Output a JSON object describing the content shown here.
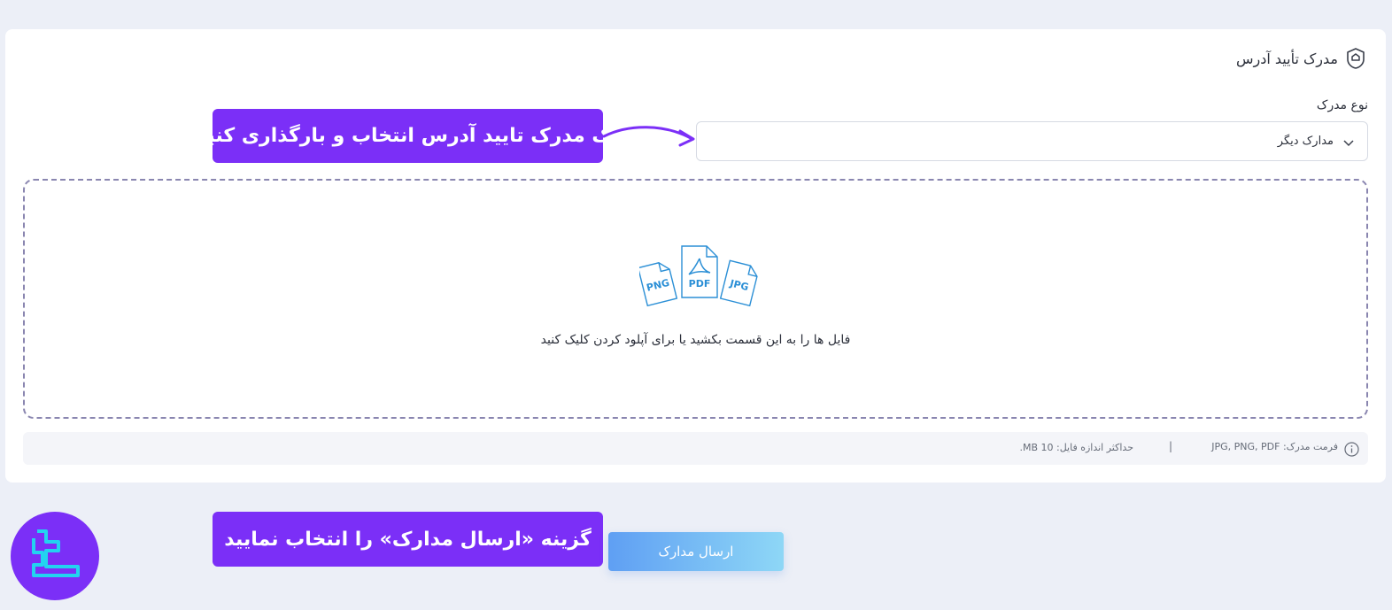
{
  "section": {
    "title": "مدرک تأیید آدرس",
    "title_icon": "home-shield-icon"
  },
  "document_type": {
    "label": "نوع مدرک",
    "selected": "مدارک دیگر",
    "icon": "chevron-down-icon"
  },
  "upload": {
    "file_types": [
      "PNG",
      "PDF",
      "JPG"
    ],
    "prompt": "فایل ها را به این قسمت بکشید یا برای آپلود کردن کلیک کنید"
  },
  "info": {
    "icon": "info-icon",
    "format": "فرمت مدرک: JPG, PNG, PDF",
    "separator": "|",
    "max_size": "حداکثر اندازه فایل: 10 MB."
  },
  "submit": {
    "label": "ارسال مدارک"
  },
  "annotations": {
    "select_hint": "یک مدرک تایید آدرس انتخاب و بارگذاری کنید",
    "submit_hint": "گزینه «ارسال مدارک» را انتخاب نمایید"
  },
  "colors": {
    "accent": "#7b2ff7",
    "button_start": "#5f9ff3",
    "button_end": "#8ed7f6",
    "file_icon": "#2b8fd6"
  }
}
